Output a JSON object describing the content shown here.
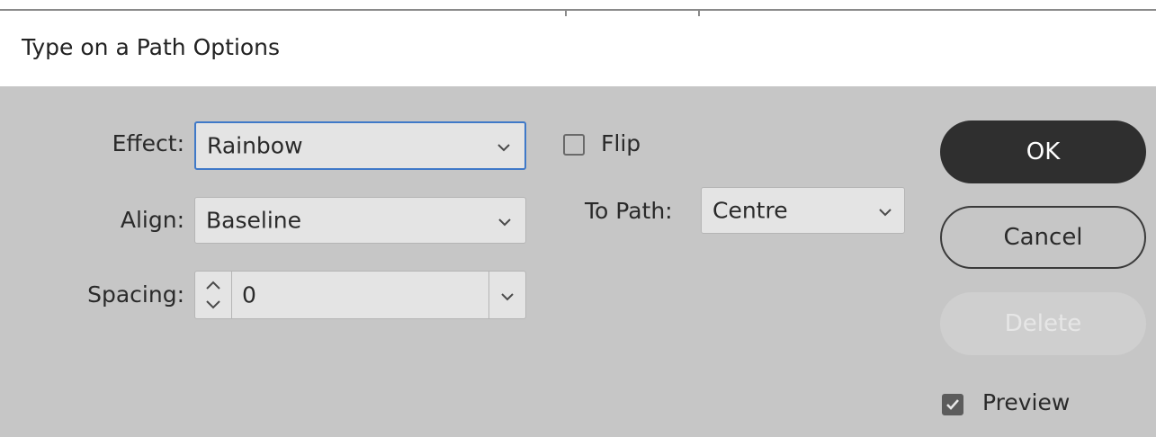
{
  "dialog": {
    "title": "Type on a Path Options"
  },
  "fields": {
    "effect_label": "Effect:",
    "effect_value": "Rainbow",
    "align_label": "Align:",
    "align_value": "Baseline",
    "spacing_label": "Spacing:",
    "spacing_value": "0",
    "flip_label": "Flip",
    "flip_checked": false,
    "to_path_label": "To Path:",
    "to_path_value": "Centre"
  },
  "buttons": {
    "ok_label": "OK",
    "cancel_label": "Cancel",
    "delete_label": "Delete",
    "delete_enabled": false
  },
  "preview": {
    "label": "Preview",
    "checked": true
  },
  "icons": {
    "dropdown": "chevron-down-icon",
    "spinner": "up-down-arrows-icon",
    "check": "checkmark-icon"
  },
  "colors": {
    "dialog_bg": "#c6c6c6",
    "title_bg": "#ffffff",
    "focus_border": "#3f79c8",
    "ok_bg": "#2f2f2f",
    "ok_text": "#ffffff",
    "field_bg": "#e4e4e4"
  }
}
